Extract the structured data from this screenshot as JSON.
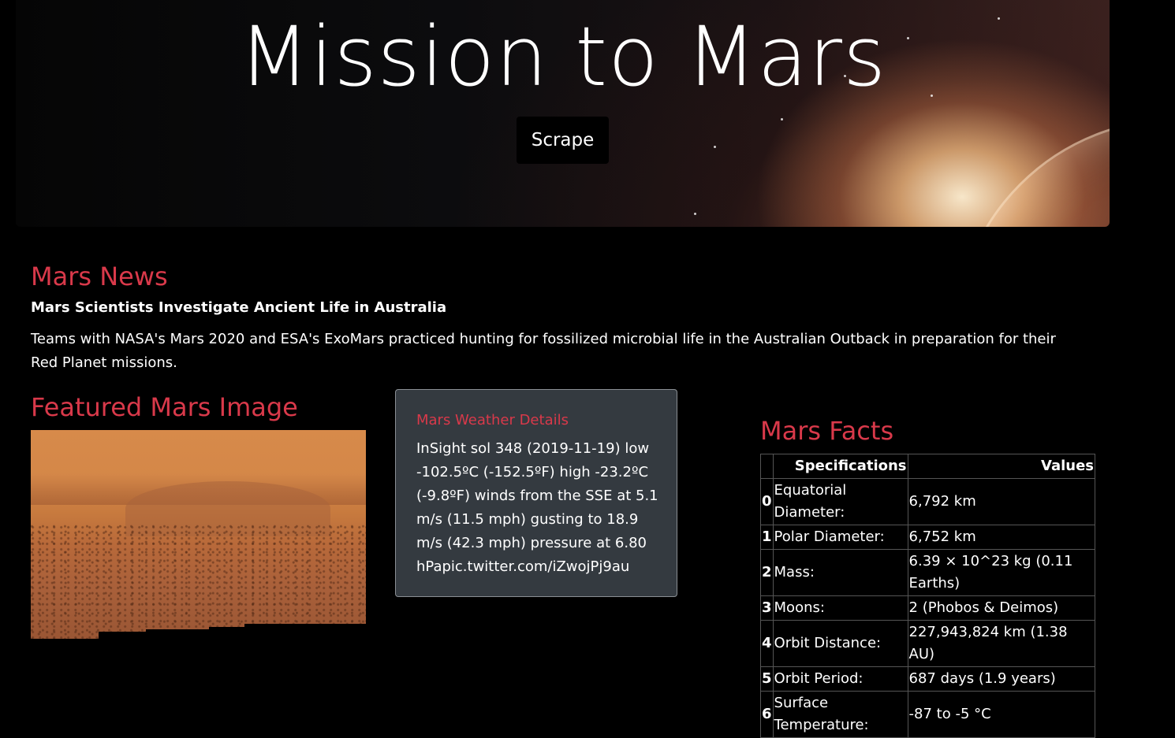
{
  "header": {
    "title": "Mission to Mars",
    "scrape_label": "Scrape"
  },
  "news": {
    "heading": "Mars News",
    "title": "Mars Scientists Investigate Ancient Life in Australia",
    "paragraph": "Teams with NASA's Mars 2020 and ESA's ExoMars practiced hunting for fossilized microbial life in the Australian Outback in preparation for their Red Planet missions."
  },
  "featured": {
    "heading": "Featured Mars Image"
  },
  "weather": {
    "heading": "Mars Weather Details",
    "text": "InSight sol 348 (2019-11-19) low -102.5ºC (-152.5ºF) high -23.2ºC (-9.8ºF) winds from the SSE at 5.1 m/s (11.5 mph) gusting to 18.9 m/s (42.3 mph) pressure at 6.80 hPapic.twitter.com/iZwojPj9au"
  },
  "facts": {
    "heading": "Mars Facts",
    "columns": [
      "",
      "Specifications",
      "Values"
    ],
    "rows": [
      {
        "idx": "0",
        "spec": "Equatorial Diameter:",
        "value": "6,792 km"
      },
      {
        "idx": "1",
        "spec": "Polar Diameter:",
        "value": "6,752 km"
      },
      {
        "idx": "2",
        "spec": "Mass:",
        "value": "6.39 × 10^23 kg (0.11 Earths)"
      },
      {
        "idx": "3",
        "spec": "Moons:",
        "value": "2 (Phobos & Deimos)"
      },
      {
        "idx": "4",
        "spec": "Orbit Distance:",
        "value": "227,943,824 km (1.38 AU)"
      },
      {
        "idx": "5",
        "spec": "Orbit Period:",
        "value": "687 days (1.9 years)"
      },
      {
        "idx": "6",
        "spec": "Surface Temperature:",
        "value": "-87 to -5 °C"
      }
    ]
  },
  "colors": {
    "accent": "#d9394a",
    "card": "#343a40",
    "background": "#000000"
  }
}
